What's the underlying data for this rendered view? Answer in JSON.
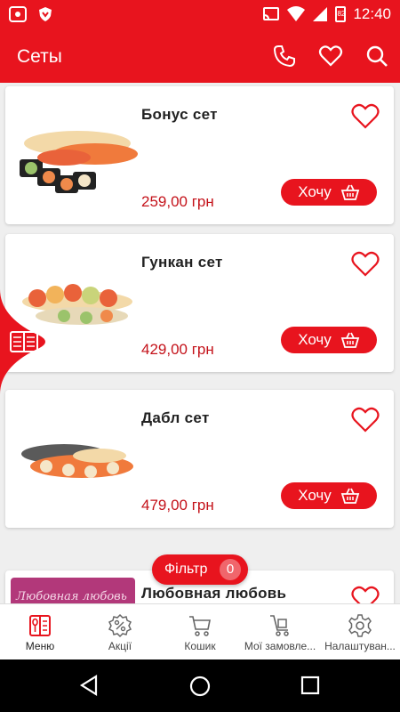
{
  "status_bar": {
    "time": "12:40",
    "battery_label": "82"
  },
  "app_bar": {
    "title": "Сеты"
  },
  "products": [
    {
      "name": "Бонус сет",
      "price": "259,00 грн",
      "button": "Хочу"
    },
    {
      "name": "Гункан сет",
      "price": "429,00 грн",
      "button": "Хочу"
    },
    {
      "name": "Дабл сет",
      "price": "479,00 грн",
      "button": "Хочу"
    },
    {
      "name": "Любовная любовь",
      "image_caption": "Любовная любовь"
    }
  ],
  "filter": {
    "label": "Фільтр",
    "count": "0"
  },
  "bottom_nav": [
    {
      "label": "Меню",
      "icon": "menu-book-icon",
      "active": true
    },
    {
      "label": "Акції",
      "icon": "percent-badge-icon"
    },
    {
      "label": "Кошик",
      "icon": "cart-icon"
    },
    {
      "label": "Мої замовле...",
      "icon": "order-cart-icon"
    },
    {
      "label": "Налаштуван...",
      "icon": "gear-icon"
    }
  ],
  "colors": {
    "accent": "#e8141e",
    "price": "#c4121a",
    "nav_bg": "#000000"
  }
}
